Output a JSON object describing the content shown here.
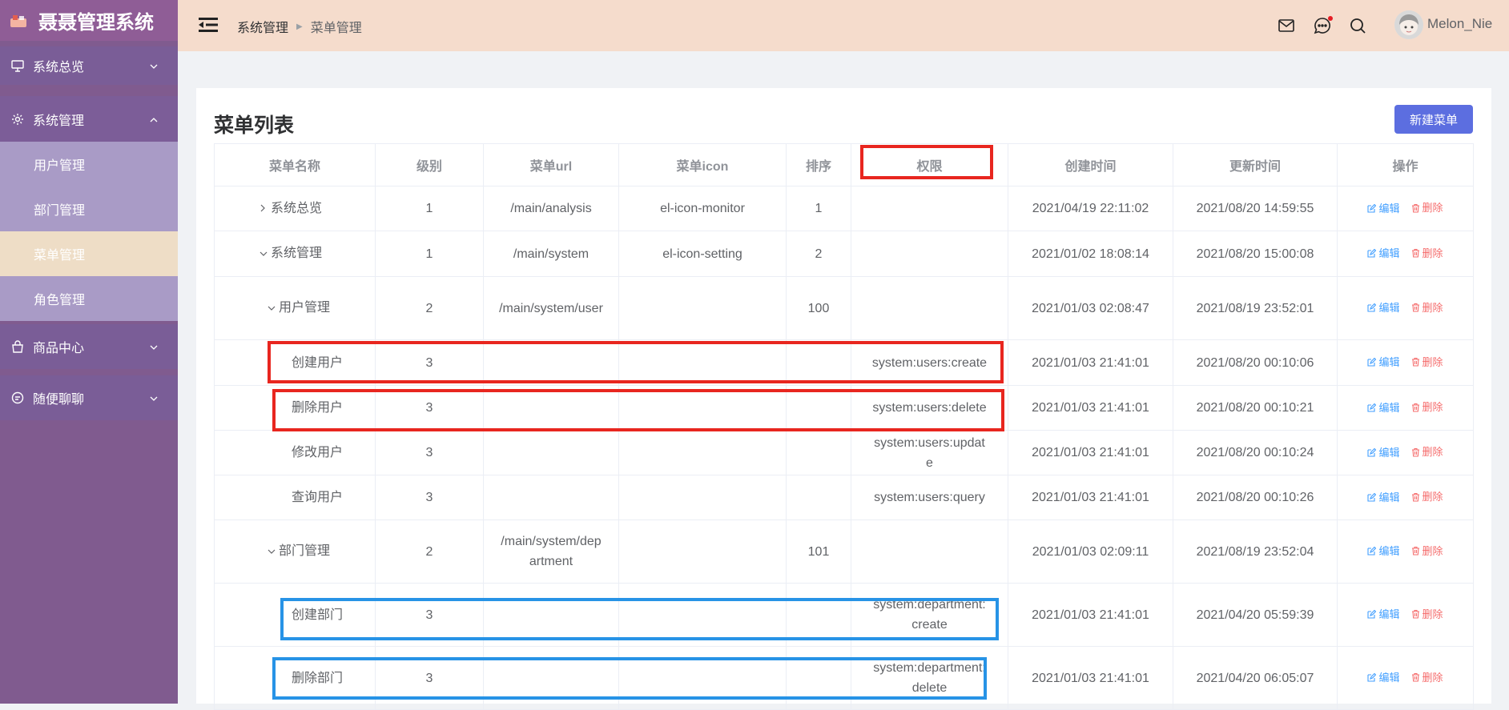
{
  "app": {
    "title": "聂聂管理系统"
  },
  "sidebar": {
    "items": [
      {
        "label": "系统总览",
        "icon": "monitor-icon",
        "expanded": false
      },
      {
        "label": "系统管理",
        "icon": "setting-icon",
        "expanded": true,
        "children": [
          {
            "label": "用户管理",
            "active": false
          },
          {
            "label": "部门管理",
            "active": false
          },
          {
            "label": "菜单管理",
            "active": true
          },
          {
            "label": "角色管理",
            "active": false
          }
        ]
      },
      {
        "label": "商品中心",
        "icon": "goods-icon",
        "expanded": false
      },
      {
        "label": "随便聊聊",
        "icon": "chat-icon",
        "expanded": false
      }
    ]
  },
  "header": {
    "breadcrumb": [
      "系统管理",
      "菜单管理"
    ],
    "username": "Melon_Nie"
  },
  "card": {
    "title": "菜单列表",
    "new_button": "新建菜单"
  },
  "table": {
    "columns": [
      "菜单名称",
      "级别",
      "菜单url",
      "菜单icon",
      "排序",
      "权限",
      "创建时间",
      "更新时间",
      "操作"
    ],
    "rows": [
      {
        "name": "系统总览",
        "level": "1",
        "url": "/main/analysis",
        "icon": "el-icon-monitor",
        "sort": "1",
        "permission": "",
        "created": "2021/04/19 22:11:02",
        "updated": "2021/08/20 14:59:55",
        "arrow": "›",
        "indent": 0
      },
      {
        "name": "系统管理",
        "level": "1",
        "url": "/main/system",
        "icon": "el-icon-setting",
        "sort": "2",
        "permission": "",
        "created": "2021/01/02 18:08:14",
        "updated": "2021/08/20 15:00:08",
        "arrow": "⌄",
        "indent": 0
      },
      {
        "name": "用户管理",
        "level": "2",
        "url": "/main/system/user",
        "icon": "",
        "sort": "100",
        "permission": "",
        "created": "2021/01/03 02:08:47",
        "updated": "2021/08/19 23:52:01",
        "arrow": "⌄",
        "indent": 1
      },
      {
        "name": "创建用户",
        "level": "3",
        "url": "",
        "icon": "",
        "sort": "",
        "permission": "system:users:create",
        "created": "2021/01/03 21:41:01",
        "updated": "2021/08/20 00:10:06",
        "arrow": "",
        "indent": 2
      },
      {
        "name": "删除用户",
        "level": "3",
        "url": "",
        "icon": "",
        "sort": "",
        "permission": "system:users:delete",
        "created": "2021/01/03 21:41:01",
        "updated": "2021/08/20 00:10:21",
        "arrow": "",
        "indent": 2
      },
      {
        "name": "修改用户",
        "level": "3",
        "url": "",
        "icon": "",
        "sort": "",
        "permission": "system:users:update",
        "created": "2021/01/03 21:41:01",
        "updated": "2021/08/20 00:10:24",
        "arrow": "",
        "indent": 2
      },
      {
        "name": "查询用户",
        "level": "3",
        "url": "",
        "icon": "",
        "sort": "",
        "permission": "system:users:query",
        "created": "2021/01/03 21:41:01",
        "updated": "2021/08/20 00:10:26",
        "arrow": "",
        "indent": 2
      },
      {
        "name": "部门管理",
        "level": "2",
        "url": "/main/system/department",
        "icon": "",
        "sort": "101",
        "permission": "",
        "created": "2021/01/03 02:09:11",
        "updated": "2021/08/19 23:52:04",
        "arrow": "⌄",
        "indent": 1
      },
      {
        "name": "创建部门",
        "level": "3",
        "url": "",
        "icon": "",
        "sort": "",
        "permission": "system:department:create",
        "created": "2021/01/03 21:41:01",
        "updated": "2021/04/20 05:59:39",
        "arrow": "",
        "indent": 2
      },
      {
        "name": "删除部门",
        "level": "3",
        "url": "",
        "icon": "",
        "sort": "",
        "permission": "system:department:delete",
        "created": "2021/01/03 21:41:01",
        "updated": "2021/04/20 06:05:07",
        "arrow": "",
        "indent": 2
      }
    ],
    "actions": {
      "edit": "编辑",
      "delete": "删除"
    }
  },
  "colors": {
    "sidebar_bg": "#805b8f",
    "submenu_bg": "#a99bc6",
    "active_submenu_bg": "#eeddc6",
    "header_bg": "#f5dccc",
    "primary_button": "#5c6ee0",
    "annotation_red": "#e8261f",
    "annotation_blue": "#2793e6"
  }
}
